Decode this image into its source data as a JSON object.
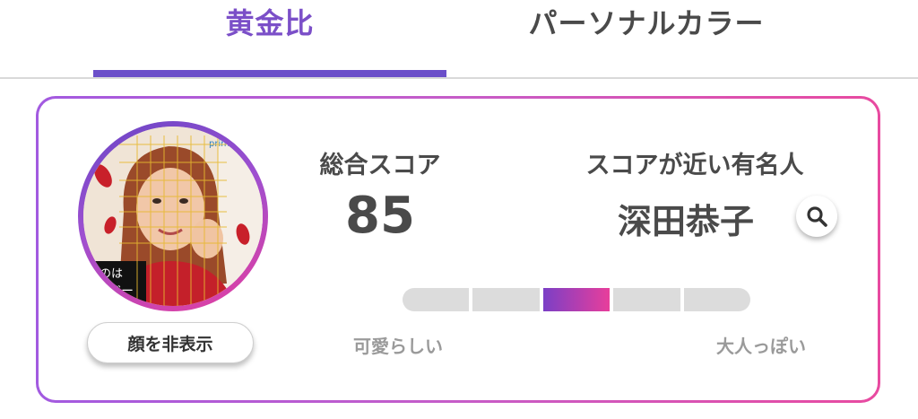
{
  "tabs": {
    "golden_ratio": "黄金比",
    "personal_color": "パーソナルカラー"
  },
  "avatar": {
    "overlay_badge": "prime",
    "overlay_text_line1": "のは",
    "overlay_text_line2": "クジー"
  },
  "buttons": {
    "hide_face": "顔を非表示"
  },
  "score": {
    "title": "総合スコア",
    "value": "85"
  },
  "celebrity": {
    "title": "スコアが近い有名人",
    "name": "深田恭子"
  },
  "scale": {
    "left_label": "可愛らしい",
    "right_label": "大人っぽい",
    "segments": 5,
    "active_segment": 3
  },
  "colors": {
    "accent_purple": "#6b4fc9",
    "accent_pink": "#e83e9b",
    "inactive_gray": "#dcdcdc"
  }
}
